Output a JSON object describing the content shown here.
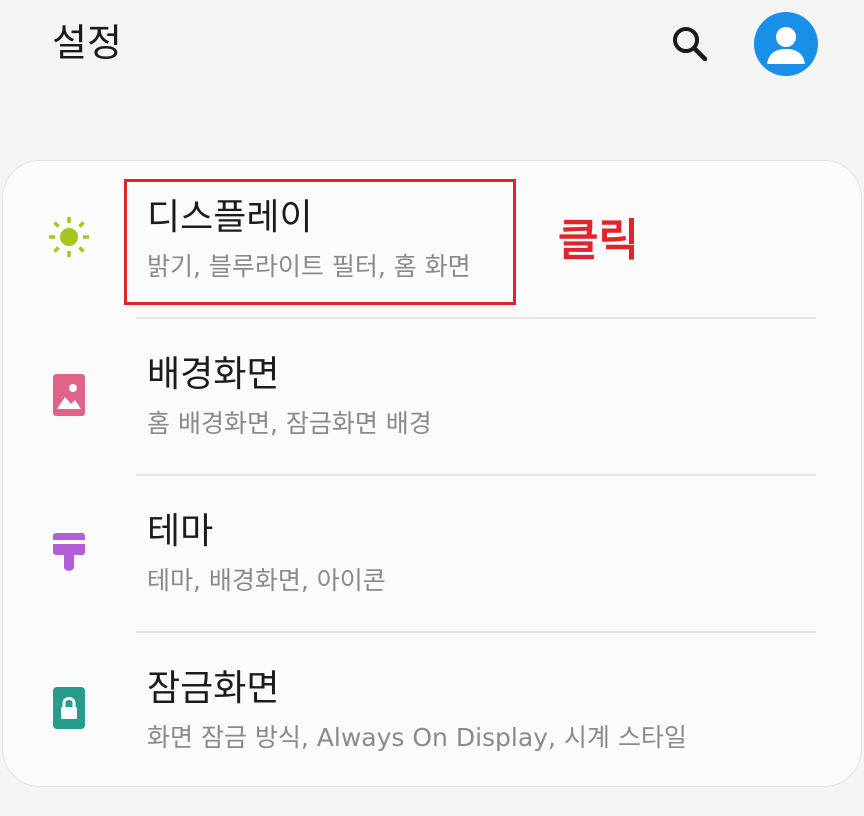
{
  "app_bar": {
    "title": "설정",
    "search_icon": "search-icon",
    "avatar_icon": "account-icon",
    "avatar_color": "#1a8fe8"
  },
  "items": [
    {
      "title": "디스플레이",
      "subtitle": "밝기, 블루라이트 필터, 홈 화면",
      "icon": "brightness-icon",
      "icon_color": "#a4c720"
    },
    {
      "title": "배경화면",
      "subtitle": "홈 배경화면, 잠금화면 배경",
      "icon": "wallpaper-icon",
      "icon_color": "#e2638a"
    },
    {
      "title": "테마",
      "subtitle": "테마, 배경화면, 아이콘",
      "icon": "theme-brush-icon",
      "icon_color": "#b25ed6"
    },
    {
      "title": "잠금화면",
      "subtitle": "화면 잠금 방식, Always On Display, 시계 스타일",
      "icon": "lock-icon",
      "icon_color": "#259c8c"
    }
  ],
  "annotation": {
    "label": "클릭",
    "color": "#e0242b"
  }
}
